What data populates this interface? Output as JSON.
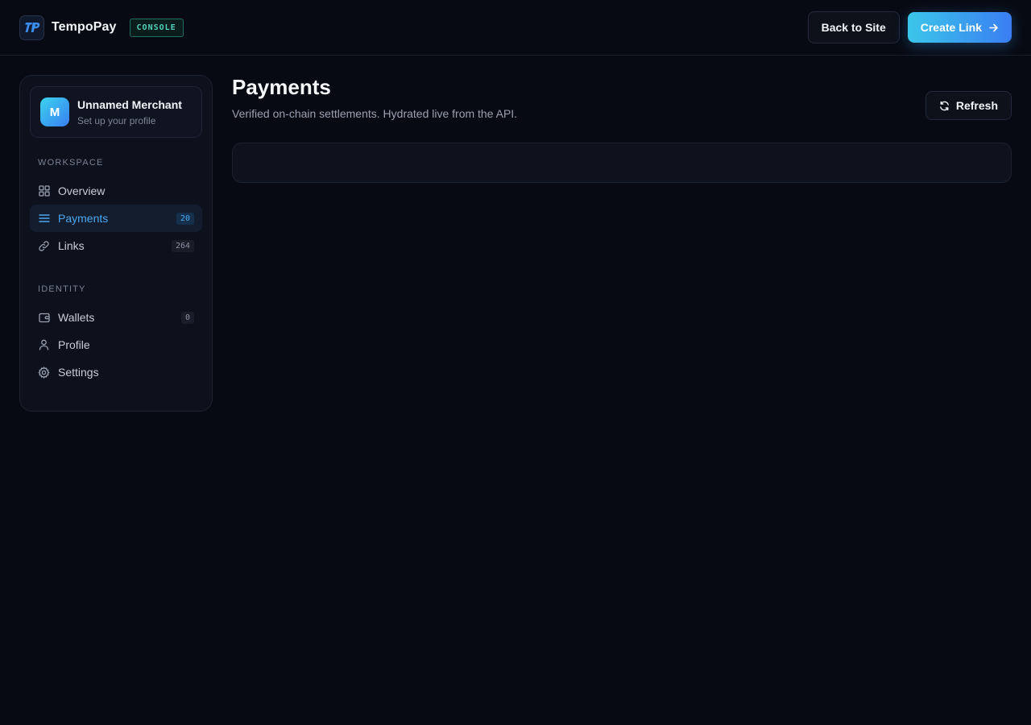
{
  "header": {
    "brand": "TempoPay",
    "badge": "CONSOLE",
    "back_label": "Back to Site",
    "create_label": "Create Link",
    "logo_icon": "tempopay-logo-icon",
    "create_icon": "arrow-right-icon"
  },
  "sidebar": {
    "merchant": {
      "initial": "M",
      "name": "Unnamed Merchant",
      "subtitle": "Set up your profile"
    },
    "sections": [
      {
        "title": "WORKSPACE",
        "items": [
          {
            "label": "Overview",
            "icon": "grid-icon",
            "count": null,
            "active": false
          },
          {
            "label": "Payments",
            "icon": "list-icon",
            "count": "20",
            "active": true
          },
          {
            "label": "Links",
            "icon": "link-icon",
            "count": "264",
            "active": false
          }
        ]
      },
      {
        "title": "IDENTITY",
        "items": [
          {
            "label": "Wallets",
            "icon": "wallet-icon",
            "count": "0",
            "active": false
          },
          {
            "label": "Profile",
            "icon": "user-icon",
            "count": null,
            "active": false
          },
          {
            "label": "Settings",
            "icon": "gear-icon",
            "count": null,
            "active": false
          }
        ]
      }
    ]
  },
  "main": {
    "title": "Payments",
    "subtitle": "Verified on-chain settlements. Hydrated live from the API.",
    "refresh_label": "Refresh",
    "refresh_icon": "refresh-icon"
  },
  "colors": {
    "background": "#070a12",
    "accent": "#4aa8f0",
    "gradient_start": "#3bc6ea",
    "gradient_end": "#3a7ef2",
    "badge_text": "#4fd1b8"
  }
}
